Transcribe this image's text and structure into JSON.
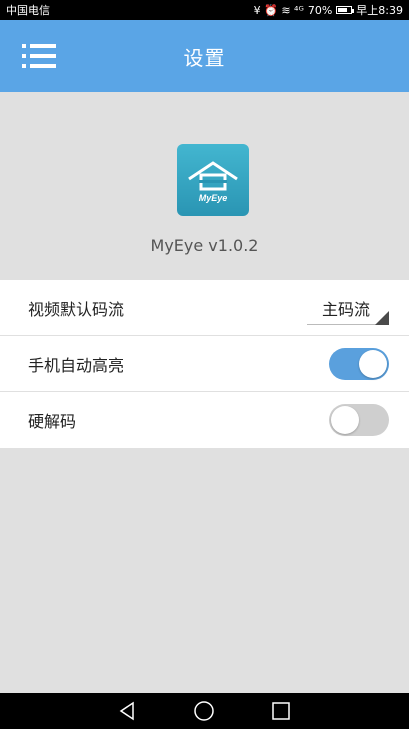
{
  "status_bar": {
    "carrier": "中国电信",
    "battery": "70%",
    "time": "早上8:39",
    "signal_icons": "¥ ⏰ ≋ ⁴ᴳ"
  },
  "app_bar": {
    "title": "设置",
    "color": "#5aa5e6"
  },
  "app_info": {
    "logo_text": "MyEye",
    "version": "MyEye v1.0.2"
  },
  "settings": [
    {
      "label": "视频默认码流",
      "control": "select",
      "value": "主码流"
    },
    {
      "label": "手机自动高亮",
      "control": "toggle",
      "state": true
    },
    {
      "label": "硬解码",
      "control": "toggle",
      "state": false
    }
  ],
  "nav_bar": {
    "icons": [
      "back-icon",
      "home-icon",
      "recents-icon"
    ]
  }
}
